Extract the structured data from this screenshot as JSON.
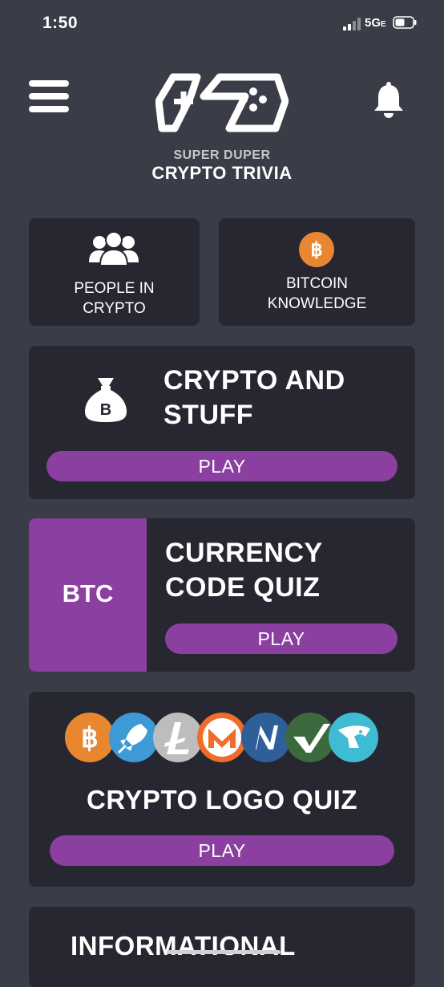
{
  "status_bar": {
    "time": "1:50",
    "network": "5G",
    "network_suffix": "E"
  },
  "header": {
    "logo_subtitle": "SUPER DUPER",
    "logo_title": "CRYPTO TRIVIA"
  },
  "categories": [
    {
      "line1": "PEOPLE IN",
      "line2": "CRYPTO",
      "icon": "people-icon"
    },
    {
      "line1": "BITCOIN",
      "line2": "KNOWLEDGE",
      "icon": "bitcoin-icon"
    }
  ],
  "quizzes": {
    "crypto_and_stuff": {
      "title_line1": "CRYPTO AND",
      "title_line2": "STUFF",
      "play": "PLAY",
      "icon": "money-bag-icon"
    },
    "currency_code": {
      "badge": "BTC",
      "title_line1": "CURRENCY",
      "title_line2": "CODE QUIZ",
      "play": "PLAY",
      "badge_color": "#8b3fa0"
    },
    "logo_quiz": {
      "title": "CRYPTO LOGO QUIZ",
      "play": "PLAY",
      "coins": [
        {
          "name": "bitcoin-logo-icon",
          "color": "#e8872f"
        },
        {
          "name": "rocket-logo-icon",
          "color": "#3d9ad6"
        },
        {
          "name": "litecoin-logo-icon",
          "color": "#bdbdbd"
        },
        {
          "name": "monero-logo-icon",
          "color": "#ef6c2b"
        },
        {
          "name": "nano-logo-icon",
          "color": "#2f5f99"
        },
        {
          "name": "check-logo-icon",
          "color": "#3c6a3e"
        },
        {
          "name": "eagle-logo-icon",
          "color": "#3fbcd3"
        }
      ]
    },
    "informational": {
      "title": "INFORMATIONAL"
    }
  },
  "colors": {
    "background": "#3a3d47",
    "card": "#262730",
    "accent": "#8b3fa0"
  }
}
